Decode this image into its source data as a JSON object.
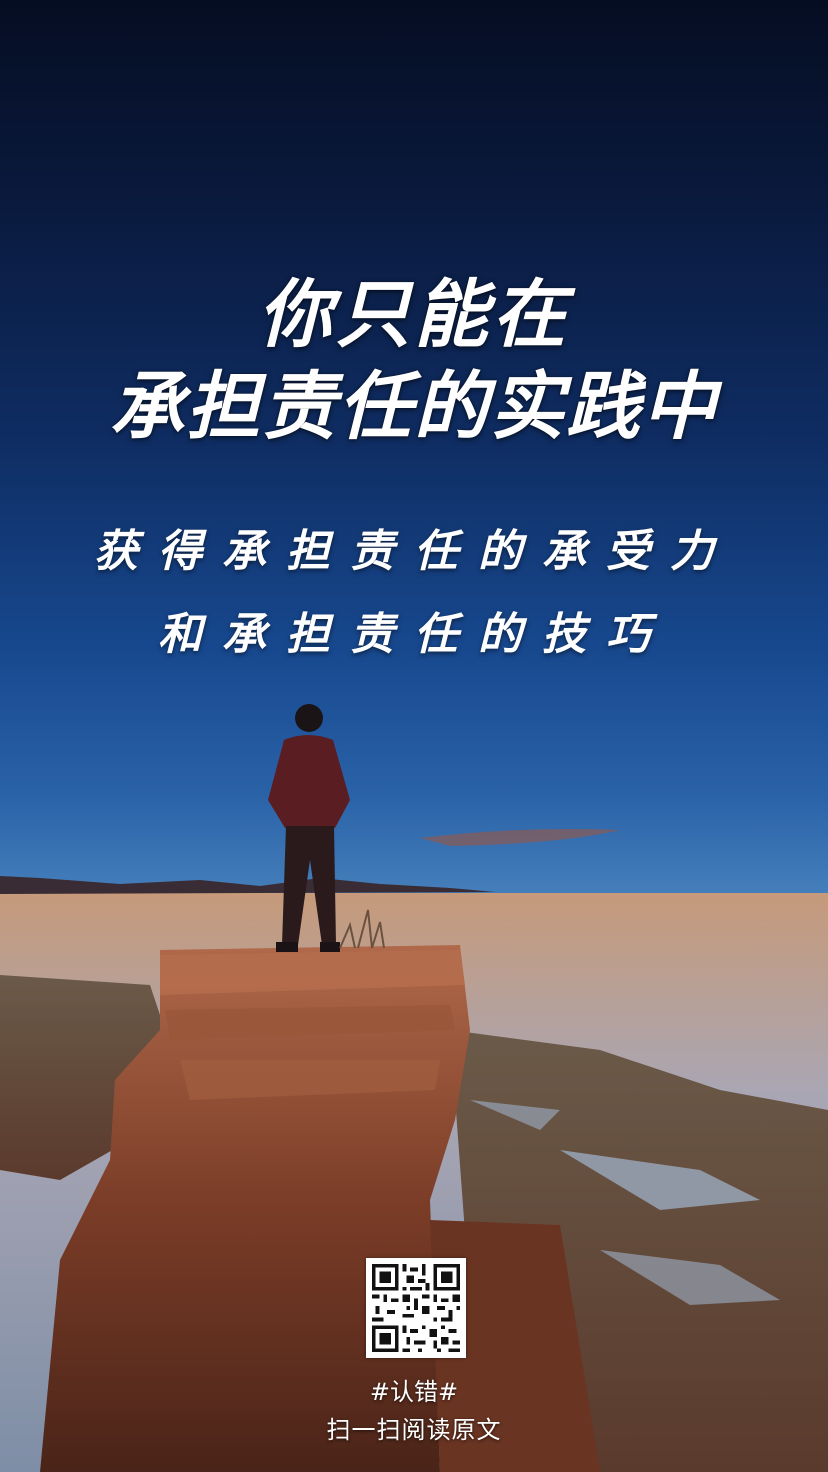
{
  "poster": {
    "headline_line1": "你只能在",
    "headline_line2": "承担责任的实践中",
    "sub_line1": "获得承担责任的承受力",
    "sub_line2": "和承担责任的技巧",
    "hashtag": "#认错#",
    "call_to_action": "扫一扫阅读原文"
  },
  "icons": {
    "qr": "qr-code-icon"
  },
  "colors": {
    "sky_top": "#050d22",
    "sky_mid": "#17488e",
    "horizon_orange": "#ec7d32",
    "rock": "#8a4a30",
    "text": "#ffffff"
  }
}
